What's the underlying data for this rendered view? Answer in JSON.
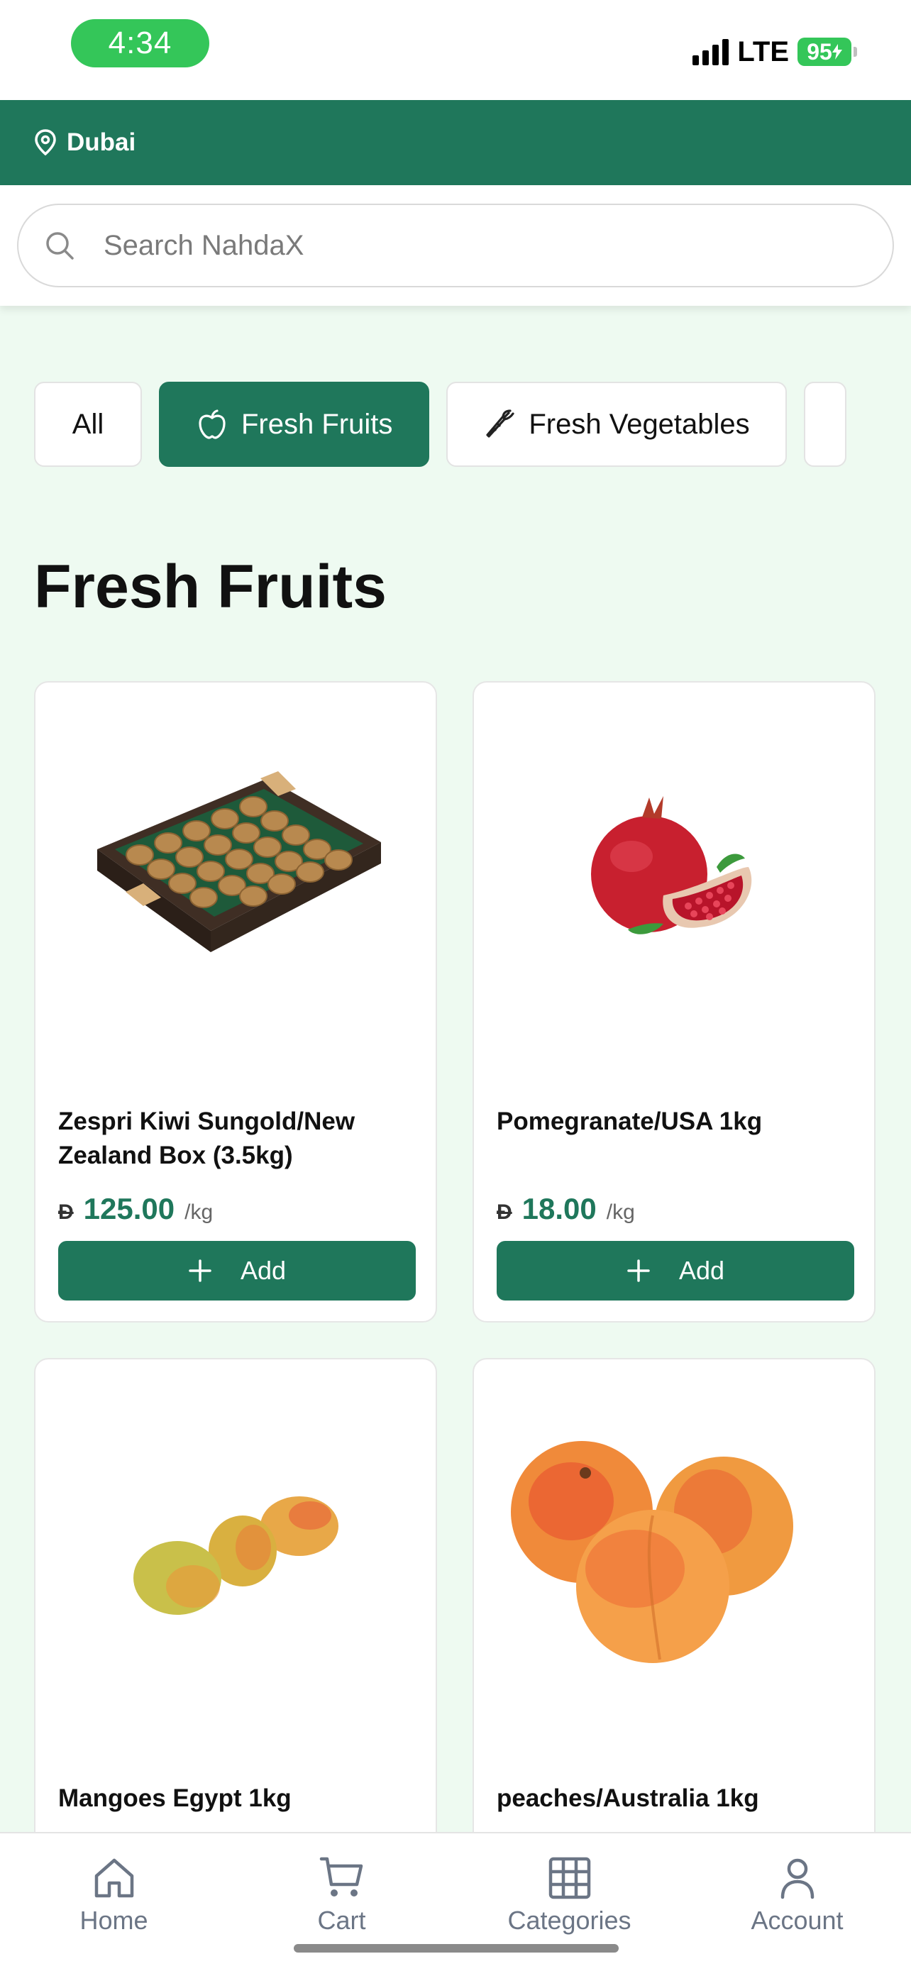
{
  "status_bar": {
    "time": "4:34",
    "network": "LTE",
    "battery": "95"
  },
  "location": {
    "city": "Dubai",
    "icon": "location-pin-icon"
  },
  "search": {
    "placeholder": "Search NahdaX",
    "icon": "search-icon"
  },
  "categories": [
    {
      "label": "All",
      "active": false
    },
    {
      "label": "Fresh Fruits",
      "active": true,
      "icon": "apple-icon"
    },
    {
      "label": "Fresh Vegetables",
      "active": false,
      "icon": "carrot-icon"
    }
  ],
  "section_title": "Fresh Fruits",
  "products": [
    {
      "name": "Zespri Kiwi Sungold/New Zealand Box (3.5kg)",
      "currency": "Đ",
      "price": "125.00",
      "unit": "/kg",
      "add_label": "Add",
      "image": "kiwi-box-image"
    },
    {
      "name": "Pomegranate/USA 1kg",
      "currency": "Đ",
      "price": "18.00",
      "unit": "/kg",
      "add_label": "Add",
      "image": "pomegranate-image"
    },
    {
      "name": "Mangoes Egypt 1kg",
      "image": "mangoes-image"
    },
    {
      "name": "peaches/Australia 1kg",
      "image": "peaches-image"
    }
  ],
  "bottom_nav": [
    {
      "label": "Home",
      "icon": "home-icon"
    },
    {
      "label": "Cart",
      "icon": "cart-icon"
    },
    {
      "label": "Categories",
      "icon": "grid-icon"
    },
    {
      "label": "Account",
      "icon": "user-icon"
    }
  ],
  "colors": {
    "brand_green": "#1f775b",
    "status_green": "#34c659",
    "background": "#eefaf1"
  }
}
